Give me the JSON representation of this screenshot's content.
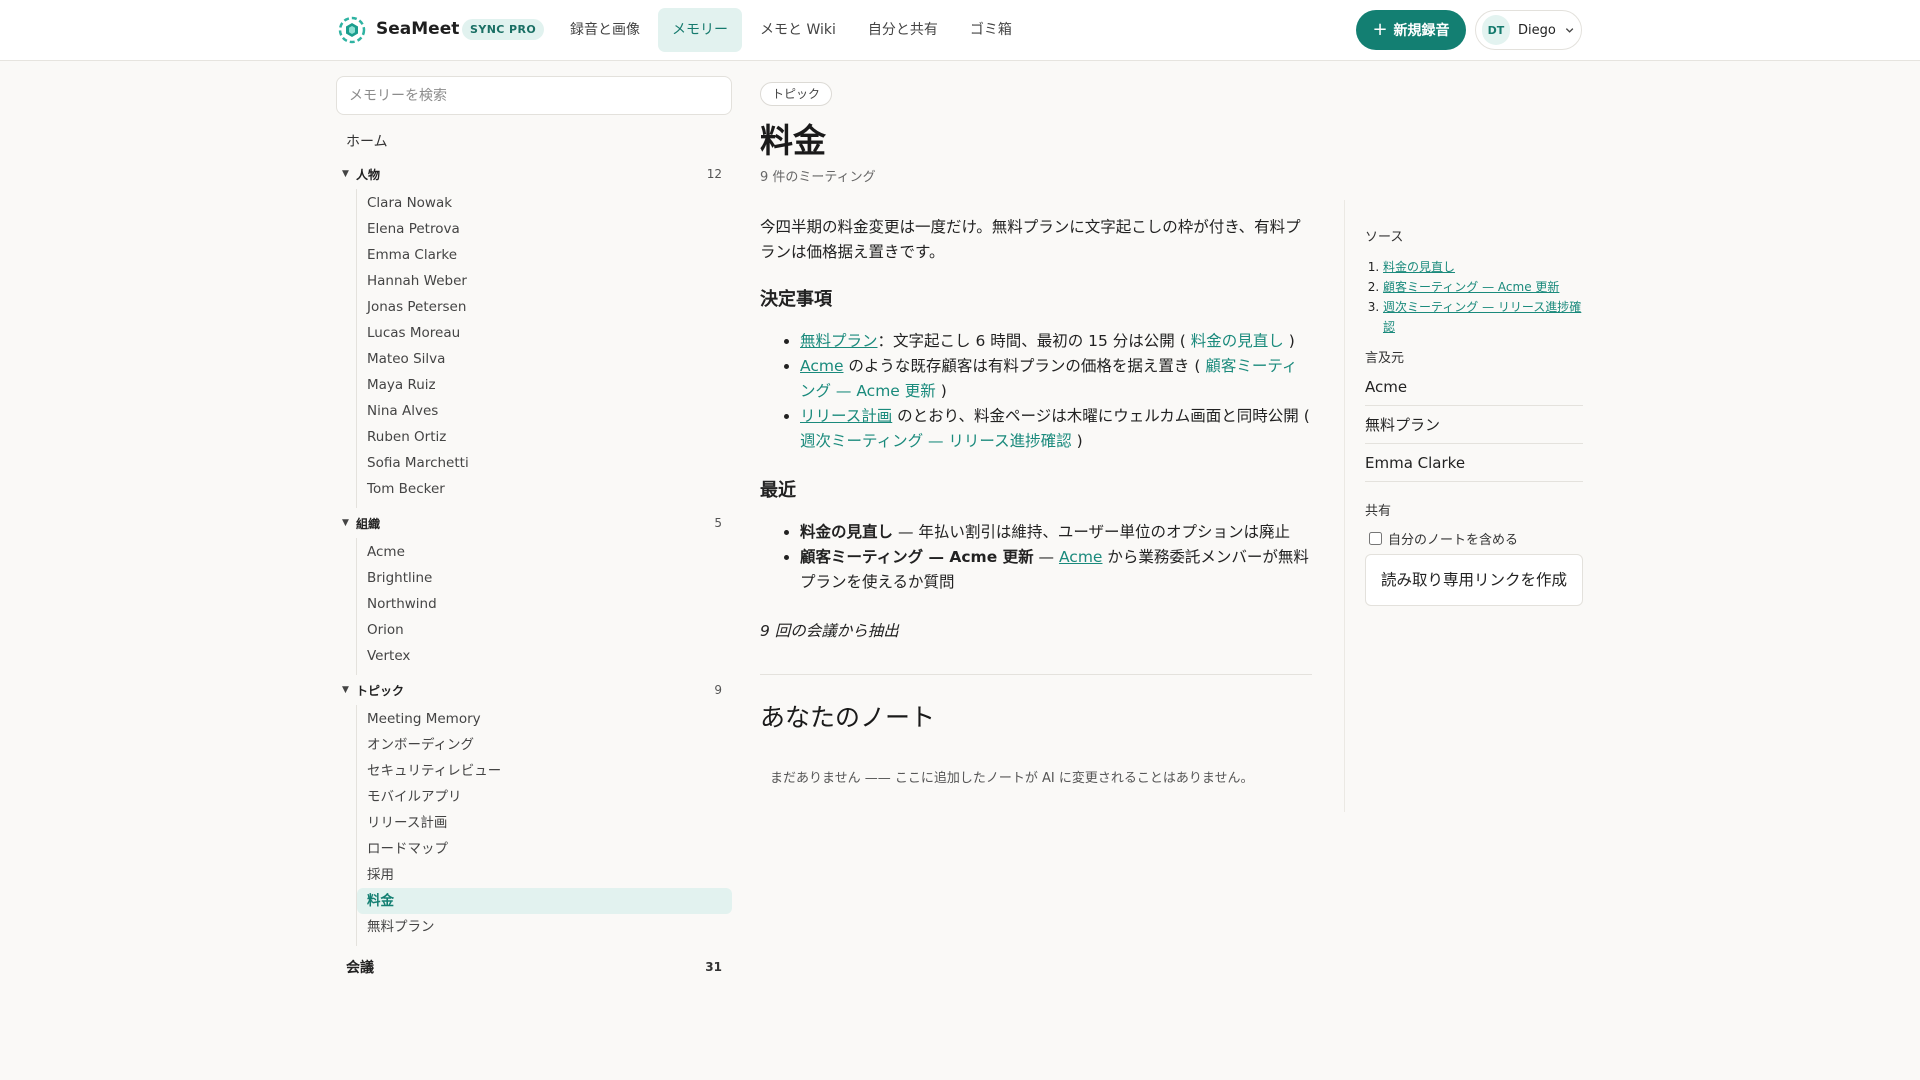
{
  "header": {
    "brand": "SeaMeet",
    "plan_badge": "SYNC PRO",
    "nav": [
      "録音と画像",
      "メモリー",
      "メモと Wiki",
      "自分と共有",
      "ゴミ箱"
    ],
    "active_nav": 1,
    "new_recording_label": "新規録音",
    "user_initials": "DT",
    "user_name": "Diego",
    "accent_color": "#137f72"
  },
  "sidebar": {
    "search_placeholder": "メモリーを検索",
    "home_label": "ホーム",
    "groups": [
      {
        "name": "人物",
        "count": "12",
        "items": [
          "Clara Nowak",
          "Elena Petrova",
          "Emma Clarke",
          "Hannah Weber",
          "Jonas Petersen",
          "Lucas Moreau",
          "Mateo Silva",
          "Maya Ruiz",
          "Nina Alves",
          "Ruben Ortiz",
          "Sofia Marchetti",
          "Tom Becker"
        ]
      },
      {
        "name": "組織",
        "count": "5",
        "items": [
          "Acme",
          "Brightline",
          "Northwind",
          "Orion",
          "Vertex"
        ]
      },
      {
        "name": "トピック",
        "count": "9",
        "items": [
          "Meeting Memory",
          "オンボーディング",
          "セキュリティレビュー",
          "モバイルアプリ",
          "リリース計画",
          "ロードマップ",
          "採用",
          "料金",
          "無料プラン"
        ]
      }
    ],
    "active_item": "料金",
    "meetings_label": "会議",
    "meetings_count": "31"
  },
  "main": {
    "tag": "トピック",
    "title": "料金",
    "subtitle": "9 件のミーティング",
    "intro": "今四半期の料金変更は一度だけ。無料プランに文字起こしの枠が付き、有料プランは価格据え置きです。",
    "decisions_heading": "決定事項",
    "decisions": [
      {
        "link": "無料プラン",
        "text": "：文字起こし 6 時間、最初の 15 分は公開 (",
        "cite": "料金の見直し",
        "end": ")"
      },
      {
        "link": "Acme",
        "text": " のような既存顧客は有料プランの価格を据え置き (",
        "cite": "顧客ミーティング — Acme 更新",
        "end": ")"
      },
      {
        "link": "リリース計画",
        "text": " のとおり、料金ページは木曜にウェルカム画面と同時公開 (",
        "cite": "週次ミーティング — リリース進捗確認",
        "end": ")"
      }
    ],
    "recent_heading": "最近",
    "recent": [
      {
        "bold": "料金の見直し",
        "text": " — 年払い割引は維持、ユーザー単位のオプションは廃止"
      },
      {
        "bold": "顧客ミーティング — Acme 更新",
        "text_before": " — ",
        "link": "Acme",
        "text": " から業務委託メンバーが無料プランを使えるか質問"
      }
    ],
    "extracted": "9 回の会議から抽出",
    "notes_heading": "あなたのノート",
    "notes_empty": "まだありません —— ここに追加したノートが AI に変更されることはありません。"
  },
  "rail": {
    "sources_label": "ソース",
    "sources": [
      "料金の見直し",
      "顧客ミーティング — Acme 更新",
      "週次ミーティング — リリース進捗確認"
    ],
    "mentions_label": "言及元",
    "mentions": [
      "Acme",
      "無料プラン",
      "Emma Clarke"
    ],
    "share_label": "共有",
    "include_notes_label": "自分のノートを含める",
    "share_button": "読み取り専用リンクを作成"
  }
}
